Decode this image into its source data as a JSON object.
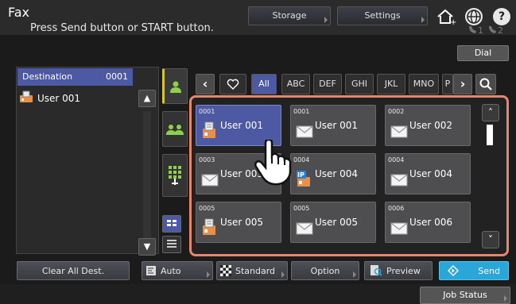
{
  "header": {
    "title": "Fax",
    "storage_label": "Storage",
    "settings_label": "Settings",
    "help_label": "?",
    "message": "Press Send button or START button.",
    "line_indicator": "§1 §2",
    "dial_label": "Dial"
  },
  "destination": {
    "label": "Destination",
    "count": "0001",
    "items": [
      {
        "icon": "fax-icon",
        "name": "User 001"
      }
    ]
  },
  "index_tabs": [
    "All",
    "ABC",
    "DEF",
    "GHI",
    "JKL",
    "MNO",
    "P"
  ],
  "active_index_tab": "All",
  "address_book": {
    "entries": [
      {
        "num": "0001",
        "name": "User 001",
        "icon": "fax-icon",
        "selected": true
      },
      {
        "num": "0001",
        "name": "User 001",
        "icon": "email-icon",
        "selected": false
      },
      {
        "num": "0002",
        "name": "User 002",
        "icon": "email-icon",
        "selected": false
      },
      {
        "num": "0003",
        "name": "User 003",
        "icon": "email-icon",
        "selected": false
      },
      {
        "num": "0004",
        "name": "User 004",
        "icon": "ip-fax-icon",
        "selected": false
      },
      {
        "num": "0004",
        "name": "User 004",
        "icon": "email-icon",
        "selected": false
      },
      {
        "num": "0005",
        "name": "User 005",
        "icon": "fax-icon",
        "selected": false
      },
      {
        "num": "0005",
        "name": "User 005",
        "icon": "email-icon",
        "selected": false
      },
      {
        "num": "0006",
        "name": "User 006",
        "icon": "email-icon",
        "selected": false
      }
    ]
  },
  "bottom": {
    "clear_all": "Clear All Dest.",
    "auto": "Auto",
    "standard": "Standard",
    "option": "Option",
    "preview": "Preview",
    "send": "Send",
    "job_status": "Job Status"
  },
  "colors": {
    "accent": "#4d5aa3",
    "highlight_frame": "#e5866f",
    "send": "#2aa7d8"
  }
}
